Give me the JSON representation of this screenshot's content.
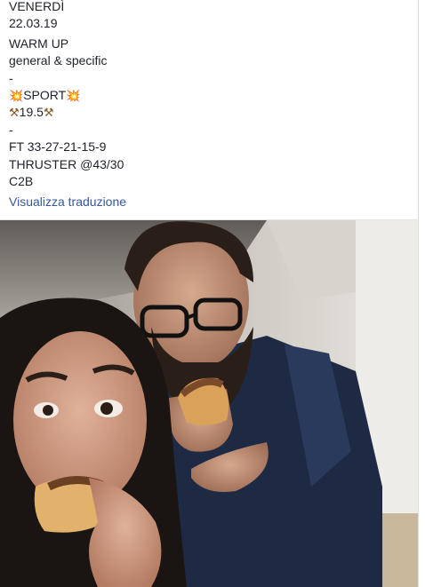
{
  "post": {
    "lines": {
      "day": "VENERDÌ",
      "date": "22.03.19",
      "warmup_title": "WARM UP",
      "warmup_sub": "general & specific",
      "sep1": "-",
      "sport_emoji_left": "💥",
      "sport_label": "SPORT",
      "sport_emoji_right": "💥",
      "pick_left": "⚒",
      "weight": "19.5",
      "pick_right": "⚒",
      "sep2": "-",
      "ft": "FT 33-27-21-15-9",
      "thruster": "THRUSTER @43/30",
      "c2b": "C2B"
    },
    "translate_link": "Visualizza traduzione"
  },
  "photo": {
    "icon": "selfie-photo",
    "colors": {
      "wall": "#c9c4bd",
      "sweater": "#1e2a44",
      "hair": "#1a1512",
      "skin": "#c99a80",
      "cake": "#d9a15a"
    }
  }
}
